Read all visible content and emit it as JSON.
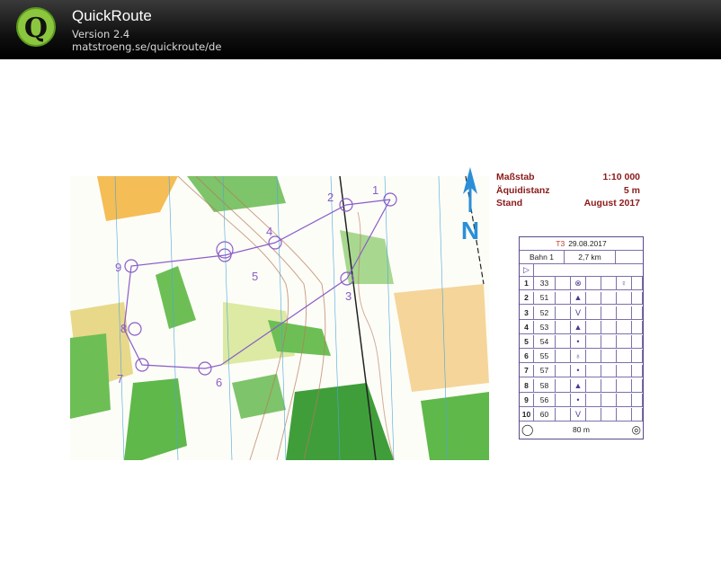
{
  "header": {
    "app_name": "QuickRoute",
    "version": "Version 2.4",
    "url": "matstroeng.se/quickroute/de",
    "logo_letter": "Q"
  },
  "map_legend": {
    "scale_label": "Maßstab",
    "scale_value": "1:10 000",
    "contour_label": "Äquidistanz",
    "contour_value": "5 m",
    "date_label": "Stand",
    "date_value": "August 2017"
  },
  "north_arrow_label": "N",
  "course_numbers": [
    "1",
    "2",
    "3",
    "4",
    "5",
    "6",
    "7",
    "8",
    "9"
  ],
  "control_card": {
    "event": "T3",
    "date": "29.08.2017",
    "course": "Bahn 1",
    "length": "2,7 km",
    "finish_distance": "80 m",
    "controls": [
      {
        "num": "1",
        "code": "33",
        "symbol": "⊗",
        "extra": "♀"
      },
      {
        "num": "2",
        "code": "51",
        "symbol": "▲",
        "extra": ""
      },
      {
        "num": "3",
        "code": "52",
        "symbol": "V",
        "extra": ""
      },
      {
        "num": "4",
        "code": "53",
        "symbol": "▲",
        "extra": ""
      },
      {
        "num": "5",
        "code": "54",
        "symbol": "•",
        "extra": ""
      },
      {
        "num": "6",
        "code": "55",
        "symbol": "♁",
        "extra": ""
      },
      {
        "num": "7",
        "code": "57",
        "symbol": "•",
        "extra": ""
      },
      {
        "num": "8",
        "code": "58",
        "symbol": "▲",
        "extra": ""
      },
      {
        "num": "9",
        "code": "56",
        "symbol": "•",
        "extra": ""
      },
      {
        "num": "10",
        "code": "60",
        "symbol": "V",
        "extra": ""
      }
    ]
  }
}
